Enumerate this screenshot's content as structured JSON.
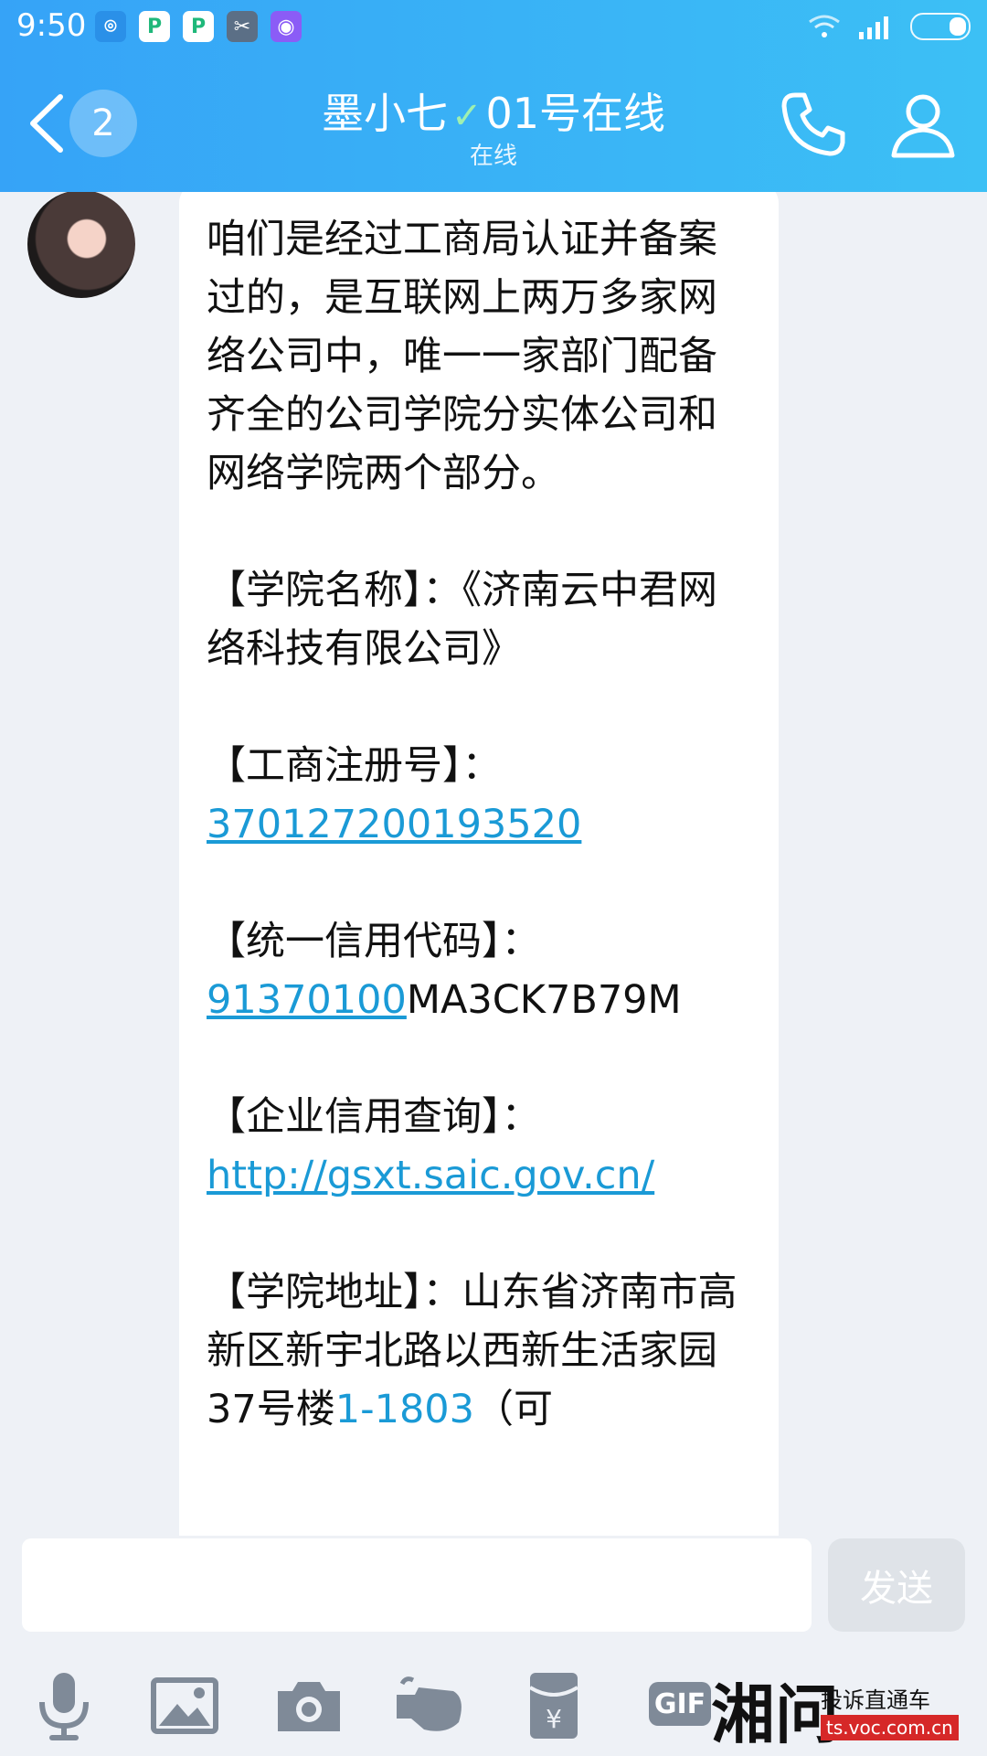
{
  "status": {
    "time": "9:50"
  },
  "header": {
    "back_count": "2",
    "contact_name": "墨小七",
    "contact_suffix": "01号在线",
    "status": "在线"
  },
  "message": {
    "p1": "咱们是经过工商局认证并备案过的，是互联网上两万多家网络公司中，唯一一家部门配备齐全的公司学院分实体公司和网络学院两个部分。",
    "p2": "【学院名称】：《济南云中君网络科技有限公司》",
    "reg_label": "【工商注册号】：",
    "reg_number": "370127200193520",
    "credit_label": "【统一信用代码】：",
    "credit_code_link": "91370100",
    "credit_code_rest": "MA3CK7B79M",
    "query_label": "【企业信用查询】：",
    "query_url": "http://gsxt.saic.gov.cn/",
    "address_label": "【学院地址】：",
    "address_text": "山东省济南市高新区新宇北路以西新生活家园37号楼",
    "address_room": "1-1803",
    "address_tail": "（可"
  },
  "input": {
    "send_label": "发送"
  },
  "toolbar": {
    "gif_label": "GIF"
  },
  "watermark": {
    "brand": "湘问",
    "slogan": "投诉直通车",
    "url": "ts.voc.com.cn"
  },
  "colors": {
    "header_start": "#36a3f7",
    "header_end": "#3cc0f5",
    "link": "#1a9ad6"
  }
}
